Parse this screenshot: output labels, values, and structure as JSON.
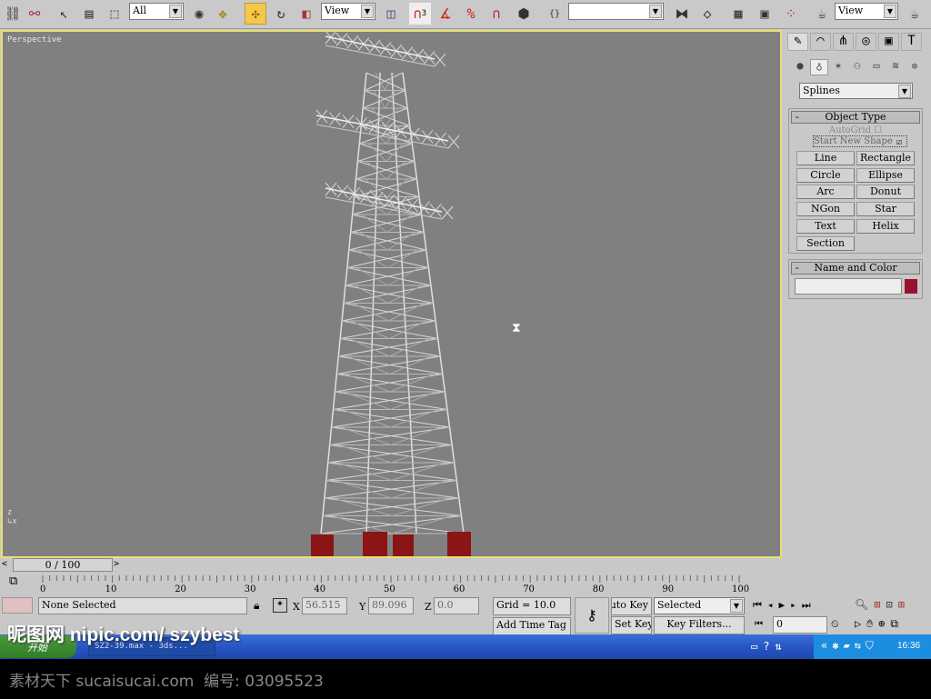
{
  "toolbar": {
    "selection_filter": "All",
    "ref_coord": "View",
    "snap_count": "3",
    "named_selection": "",
    "view_dropdown": "View",
    "icons": [
      "link-icon",
      "unlink-icon",
      "select-icon",
      "select-by-name-icon",
      "rect-selection-icon",
      "window-crossing-icon",
      "select-manipulate-icon",
      "move-icon",
      "rotate-icon",
      "scale-icon",
      "pivot-icon",
      "snap-icon",
      "angle-snap-icon",
      "percent-snap-icon",
      "spinner-snap-icon",
      "named-sets-icon",
      "mirror-icon",
      "align-icon",
      "track-view-icon",
      "schematic-icon",
      "material-editor-icon",
      "render-scene-icon",
      "quick-render-icon"
    ]
  },
  "viewport": {
    "label": "Perspective",
    "background": "#808080",
    "border_color": "#e8e070",
    "cursor": "hourglass-icon"
  },
  "panel": {
    "tabs": [
      "create-icon",
      "modify-icon",
      "hierarchy-icon",
      "motion-icon",
      "display-icon",
      "utilities-icon"
    ],
    "categories": [
      "geometry-icon",
      "shapes-icon",
      "lights-icon",
      "cameras-icon",
      "helpers-icon",
      "spacewarps-icon",
      "systems-icon"
    ],
    "category_dropdown": "Splines",
    "object_type": {
      "title": "Object Type",
      "autogrid": "AutoGrid",
      "start_new_shape": "Start New Shape",
      "start_new_shape_checked": true,
      "buttons": [
        "Line",
        "Rectangle",
        "Circle",
        "Ellipse",
        "Arc",
        "Donut",
        "NGon",
        "Star",
        "Text",
        "Helix",
        "Section"
      ]
    },
    "name_color": {
      "title": "Name and Color",
      "name_value": "",
      "color": "#9a1030"
    }
  },
  "timeline": {
    "frame": "0 / 100",
    "ticks": [
      "0",
      "10",
      "20",
      "30",
      "40",
      "50",
      "60",
      "70",
      "80",
      "90",
      "100"
    ]
  },
  "status": {
    "selection": "None Selected",
    "x_label": "X",
    "x": "56.515",
    "y_label": "Y",
    "y": "89.096",
    "z_label": "Z",
    "z": "0.0",
    "grid": "Grid = 10.0",
    "add_time_tag": "Add Time Tag",
    "auto_key": "Auto Key",
    "set_key": "Set Key",
    "key_mode": "Selected",
    "key_filters": "Key Filters...",
    "current_frame": "0"
  },
  "taskbar": {
    "start": "开始",
    "task": "SZ2-39.max - 3ds...",
    "clock": "16:36"
  },
  "watermark": {
    "top": "昵图网 nipic.com/ szybest",
    "bottom": "素材天下 sucaisucai.com  编号: 03095523"
  }
}
